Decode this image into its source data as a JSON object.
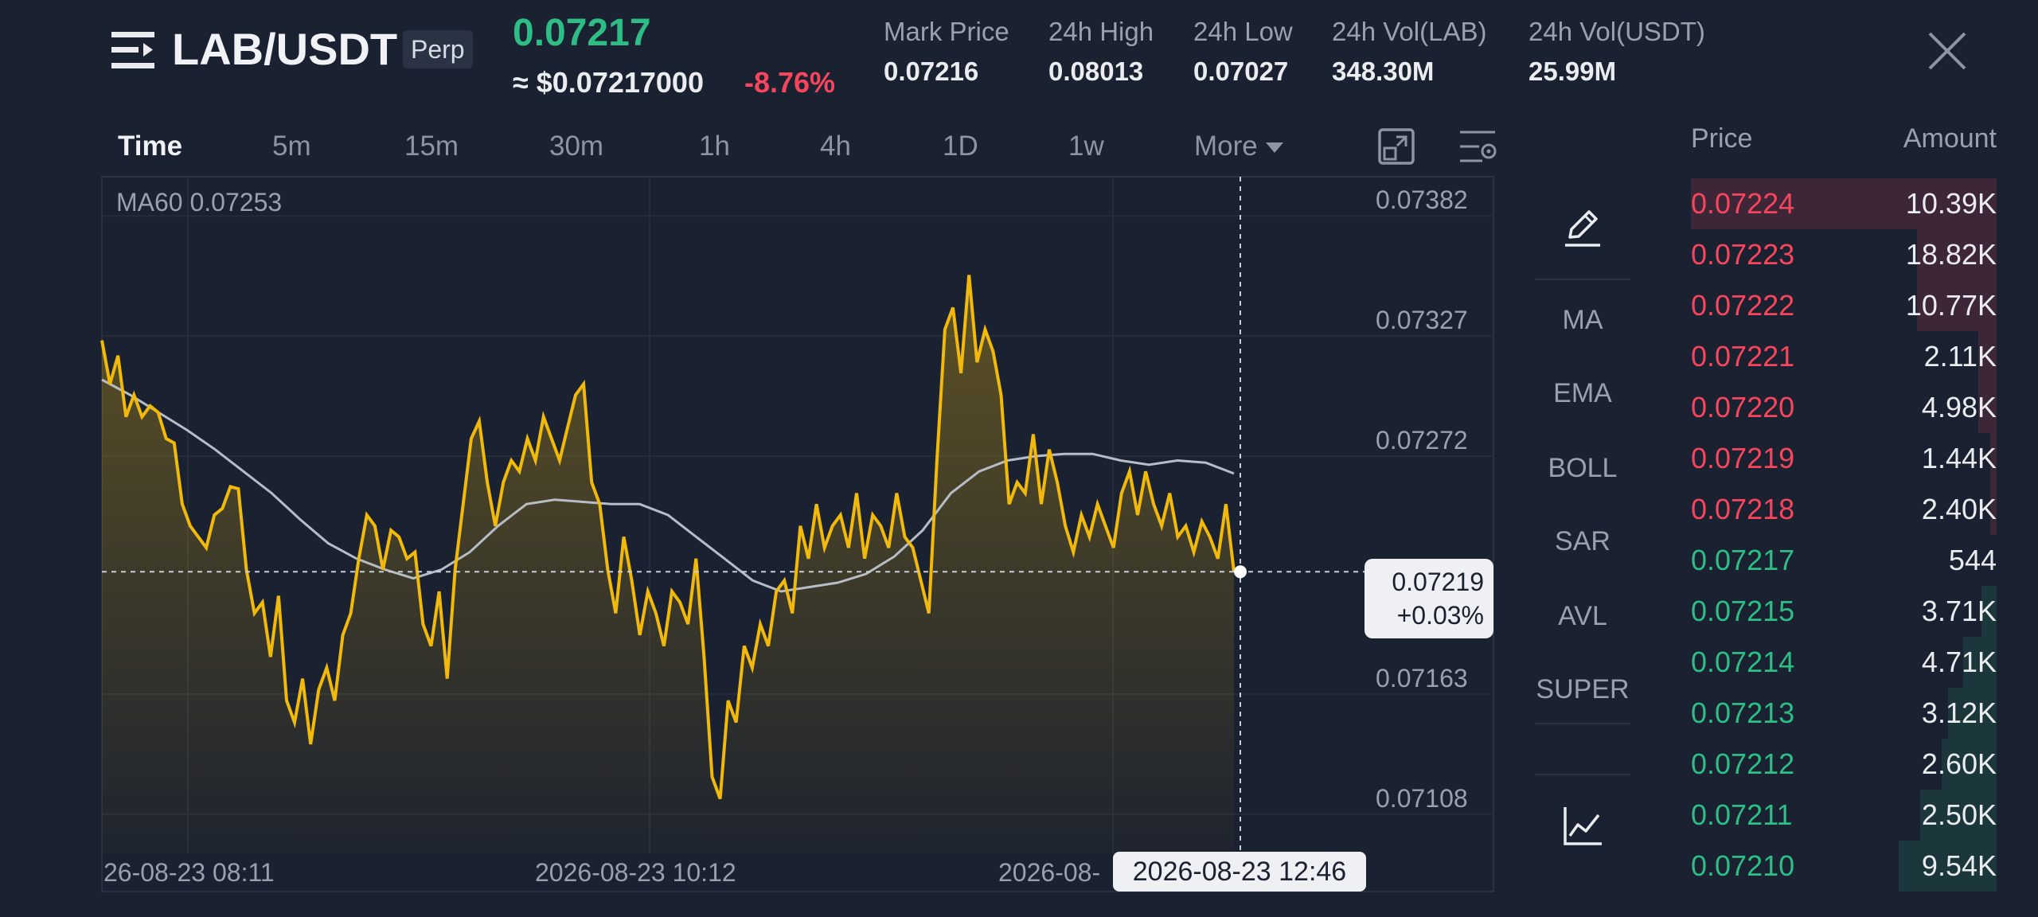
{
  "header": {
    "pair": "LAB/USDT",
    "contract_type": "Perp",
    "last_price": "0.07217",
    "usd_price": "≈ $0.07217000",
    "change_pct": "-8.76%",
    "stats": [
      {
        "label": "Mark Price",
        "value": "0.07216"
      },
      {
        "label": "24h High",
        "value": "0.08013"
      },
      {
        "label": "24h Low",
        "value": "0.07027"
      },
      {
        "label": "24h Vol(LAB)",
        "value": "348.30M"
      },
      {
        "label": "24h Vol(USDT)",
        "value": "25.99M"
      }
    ]
  },
  "toolbar": {
    "timeframes": [
      "Time",
      "5m",
      "15m",
      "30m",
      "1h",
      "4h",
      "1D",
      "1w"
    ],
    "active": "Time",
    "more_label": "More"
  },
  "indicators": {
    "items": [
      "MA",
      "EMA",
      "BOLL",
      "SAR",
      "AVL",
      "SUPER"
    ]
  },
  "tooltip": {
    "price": "0.07219",
    "change": "+0.03%",
    "time": "2026-08-23 12:46"
  },
  "order_book": {
    "price_header": "Price",
    "amount_header": "Amount",
    "asks": [
      {
        "price": "0.07224",
        "amount": "10.39K",
        "depth": 1.0
      },
      {
        "price": "0.07223",
        "amount": "18.82K",
        "depth": 0.26
      },
      {
        "price": "0.07222",
        "amount": "10.77K",
        "depth": 0.26
      },
      {
        "price": "0.07221",
        "amount": "2.11K",
        "depth": 0.06
      },
      {
        "price": "0.07220",
        "amount": "4.98K",
        "depth": 0.06
      },
      {
        "price": "0.07219",
        "amount": "1.44K",
        "depth": 0.02
      },
      {
        "price": "0.07218",
        "amount": "2.40K",
        "depth": 0.02
      }
    ],
    "bids": [
      {
        "price": "0.07217",
        "amount": "544",
        "depth": 0.0
      },
      {
        "price": "0.07215",
        "amount": "3.71K",
        "depth": 0.05
      },
      {
        "price": "0.07214",
        "amount": "4.71K",
        "depth": 0.11
      },
      {
        "price": "0.07213",
        "amount": "3.12K",
        "depth": 0.16
      },
      {
        "price": "0.07212",
        "amount": "2.60K",
        "depth": 0.18
      },
      {
        "price": "0.07211",
        "amount": "2.50K",
        "depth": 0.25
      },
      {
        "price": "0.07210",
        "amount": "9.54K",
        "depth": 0.32
      }
    ]
  },
  "colors": {
    "up": "#2ebd85",
    "down": "#f6465d",
    "line": "#f0b90b",
    "ma": "#b7bdc6"
  },
  "chart_data": {
    "type": "area",
    "indicator_label": "MA60 0.07253",
    "y_ticks": [
      "0.07382",
      "0.07327",
      "0.07272",
      "0.07163",
      "0.07108"
    ],
    "y_tick_values": [
      0.07382,
      0.07327,
      0.07272,
      0.07163,
      0.07108
    ],
    "ylim": [
      0.0709,
      0.074
    ],
    "x_tick_labels": [
      "26-08-23 08:11",
      "2026-08-23 10:12",
      "2026-08-"
    ],
    "crosshair_price": 0.07219,
    "series": [
      {
        "values": [
          0.07325,
          0.07305,
          0.07318,
          0.0729,
          0.073,
          0.0729,
          0.07295,
          0.07292,
          0.0728,
          0.07278,
          0.0725,
          0.0724,
          0.07235,
          0.0723,
          0.07245,
          0.07248,
          0.07258,
          0.07257,
          0.0722,
          0.072,
          0.07205,
          0.0718,
          0.07208,
          0.0716,
          0.0715,
          0.0717,
          0.0714,
          0.07165,
          0.07175,
          0.0716,
          0.0719,
          0.072,
          0.07225,
          0.07245,
          0.0724,
          0.0722,
          0.07238,
          0.07235,
          0.07225,
          0.07228,
          0.07195,
          0.07185,
          0.0721,
          0.0717,
          0.0722,
          0.0725,
          0.0728,
          0.07288,
          0.0726,
          0.0724,
          0.0726,
          0.0727,
          0.07265,
          0.0728,
          0.0727,
          0.0729,
          0.0728,
          0.0727,
          0.07285,
          0.073,
          0.07305,
          0.0726,
          0.0725,
          0.0722,
          0.072,
          0.07235,
          0.07215,
          0.0719,
          0.0721,
          0.072,
          0.07185,
          0.0721,
          0.07205,
          0.07195,
          0.07225,
          0.0718,
          0.07125,
          0.07115,
          0.0716,
          0.0715,
          0.07185,
          0.07175,
          0.07195,
          0.07185,
          0.0721,
          0.07215,
          0.072,
          0.0724,
          0.07225,
          0.0725,
          0.0723,
          0.0724,
          0.07245,
          0.0723,
          0.07255,
          0.07225,
          0.07245,
          0.0724,
          0.0723,
          0.07255,
          0.07235,
          0.0723,
          0.07215,
          0.072,
          0.0727,
          0.0733,
          0.0734,
          0.0731,
          0.07355,
          0.07315,
          0.0733,
          0.0732,
          0.073,
          0.0725,
          0.0726,
          0.07255,
          0.07282,
          0.0725,
          0.07275,
          0.0726,
          0.0724,
          0.07228,
          0.07245,
          0.07235,
          0.0725,
          0.0724,
          0.0723,
          0.07255,
          0.07265,
          0.07245,
          0.07265,
          0.0725,
          0.0724,
          0.07255,
          0.07235,
          0.0724,
          0.07228,
          0.07242,
          0.07235,
          0.07225,
          0.0725,
          0.07219
        ]
      },
      {
        "name": "MA60",
        "values": [
          0.07307,
          0.073,
          0.07292,
          0.07284,
          0.07275,
          0.07265,
          0.07255,
          0.07243,
          0.07232,
          0.07225,
          0.0722,
          0.07216,
          0.0722,
          0.07228,
          0.0724,
          0.0725,
          0.07252,
          0.07251,
          0.0725,
          0.0725,
          0.07245,
          0.07235,
          0.07225,
          0.07215,
          0.0721,
          0.07212,
          0.07214,
          0.07218,
          0.07226,
          0.07238,
          0.07255,
          0.07265,
          0.0727,
          0.07272,
          0.07273,
          0.07273,
          0.0727,
          0.07268,
          0.0727,
          0.07269,
          0.07264
        ]
      }
    ]
  }
}
